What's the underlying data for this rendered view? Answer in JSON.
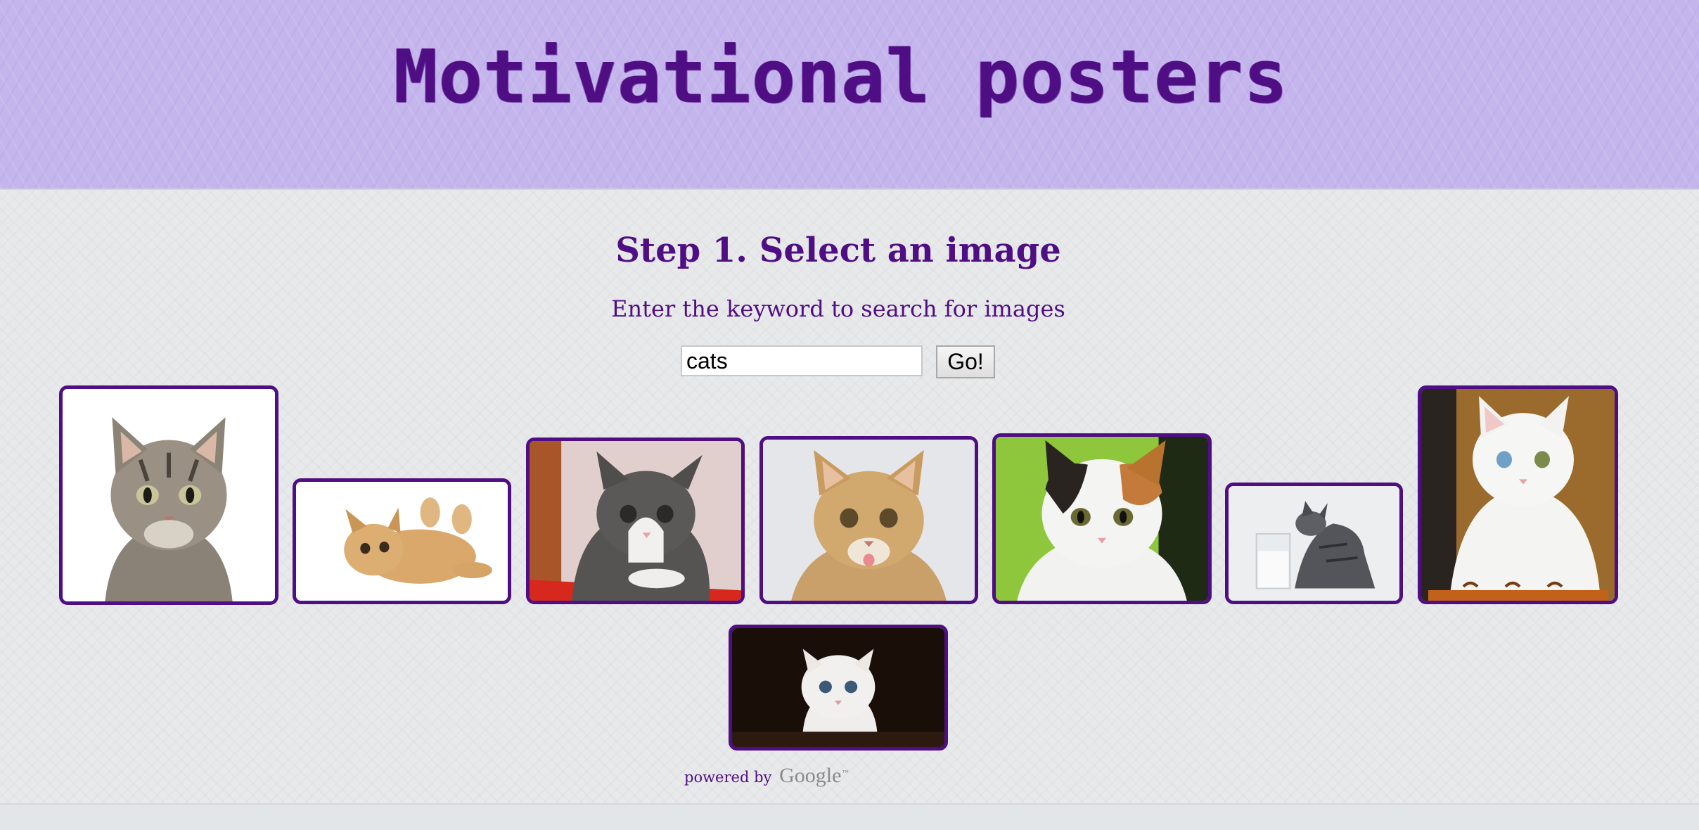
{
  "header": {
    "title": "Motivational posters"
  },
  "step": {
    "heading": "Step 1. Select an image",
    "instructions": "Enter the keyword to search for images"
  },
  "search": {
    "value": "cats",
    "button_label": "Go!"
  },
  "results": [
    {
      "name": "image-result-1",
      "depicts": "tabby kitten sitting, white background"
    },
    {
      "name": "image-result-2",
      "depicts": "orange kitten lying on its back"
    },
    {
      "name": "image-result-3",
      "depicts": "grey and white kitten on red surface"
    },
    {
      "name": "image-result-4",
      "depicts": "ginger kitten with tongue out"
    },
    {
      "name": "image-result-5",
      "depicts": "calico kitten, green background"
    },
    {
      "name": "image-result-6",
      "depicts": "tabby kitten drinking from glass of milk"
    },
    {
      "name": "image-result-7",
      "depicts": "white kitten sitting on chair"
    },
    {
      "name": "image-result-8",
      "depicts": "fluffy white kitten, dark background"
    }
  ],
  "attribution": {
    "prefix": "powered by",
    "brand": "Google",
    "trademark": "™"
  },
  "colors": {
    "accent": "#4f0e83",
    "header_bg": "#c4b5ec",
    "page_bg": "#e8e9ea"
  }
}
